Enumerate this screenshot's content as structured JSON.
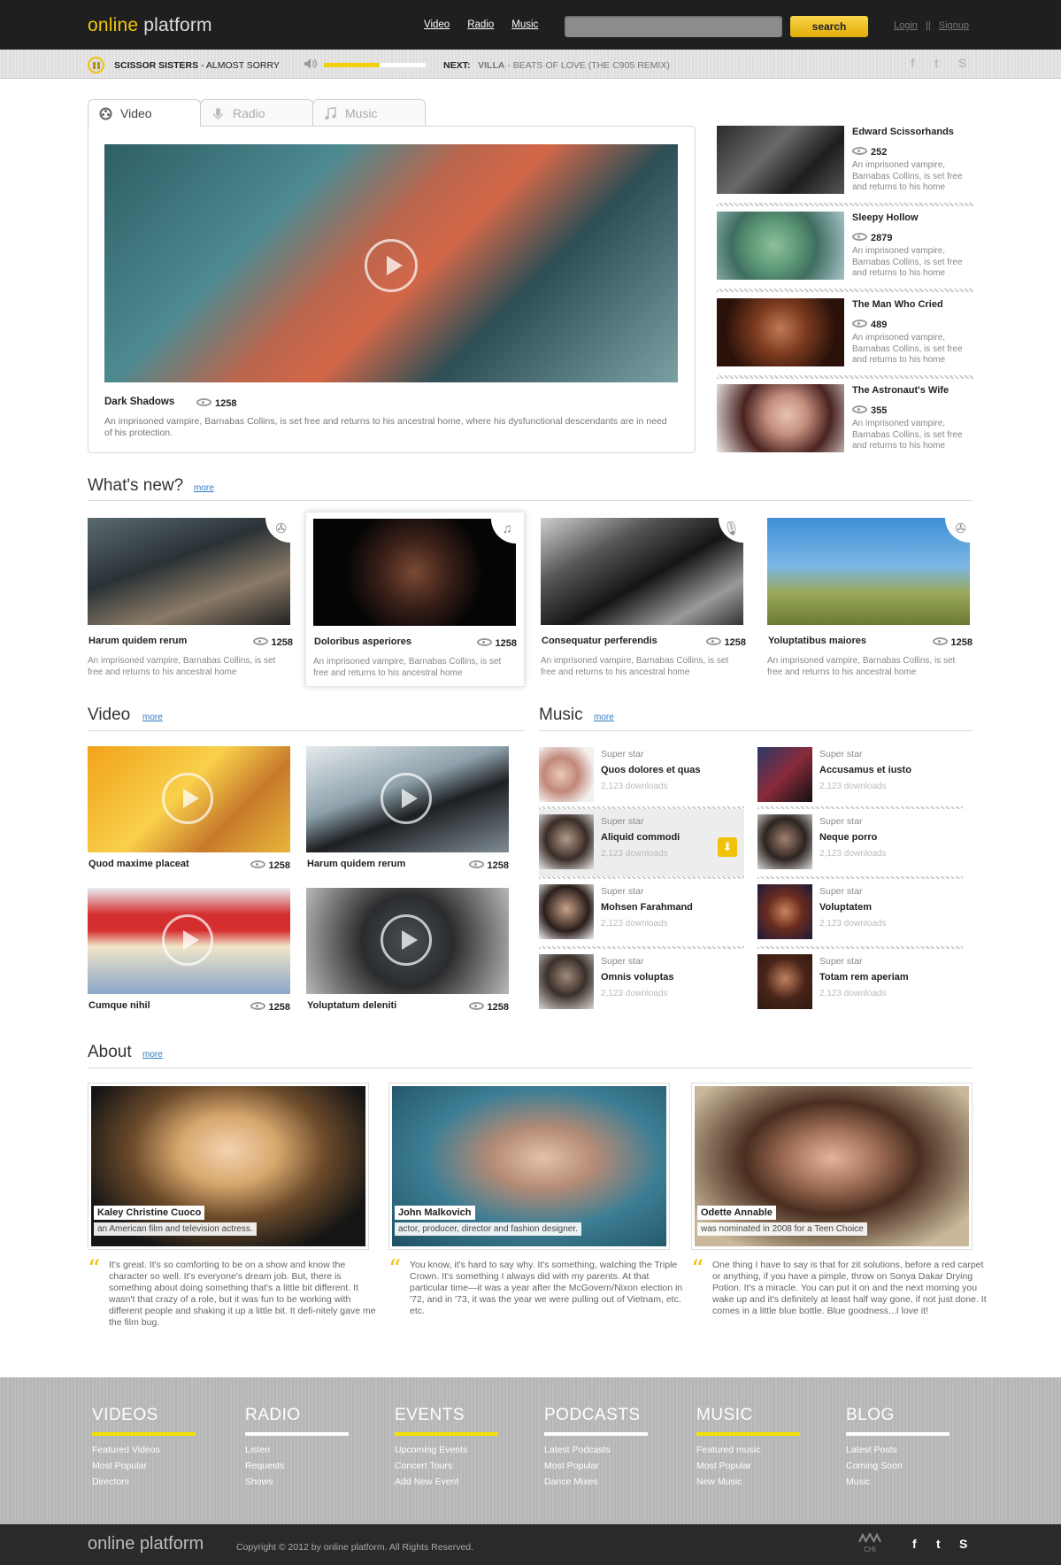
{
  "header": {
    "logo_part1": "online",
    "logo_part2": " platform",
    "nav": [
      "Video",
      "Radio",
      "Music"
    ],
    "search_placeholder": "",
    "search_button": "search",
    "login": "Login",
    "separator": "||",
    "signup": "Signup"
  },
  "player": {
    "artist": "SCISSOR SISTERS",
    "track": " - ALMOST SORRY",
    "next_label": "NEXT:",
    "next_artist": "VILLA",
    "next_track": " - BEATS OF LOVE (THE C905 REMIX)",
    "volume_level": 0.55
  },
  "tabs": [
    "Video",
    "Radio",
    "Music"
  ],
  "featured": {
    "title": "Dark Shadows",
    "views": "1258",
    "description": "An imprisoned vampire, Barnabas Collins, is set free and returns to his ancestral home, where his dysfunctional descendants are in need of his protection."
  },
  "side_list": [
    {
      "title": "Edward Scissorhands",
      "views": "252",
      "desc": "An imprisoned vampire, Barnabas Collins, is set free and returns to his home"
    },
    {
      "title": "Sleepy Hollow",
      "views": "2879",
      "desc": "An imprisoned vampire, Barnabas Collins, is set free and returns to his home"
    },
    {
      "title": "The Man Who Cried",
      "views": "489",
      "desc": "An imprisoned vampire, Barnabas Collins, is set free and returns to his home"
    },
    {
      "title": "The Astronaut's Wife",
      "views": "355",
      "desc": "An imprisoned vampire, Barnabas Collins, is set free and returns to his home"
    }
  ],
  "whats_new": {
    "title": "What's new?",
    "more": "more",
    "items": [
      {
        "title": "Harum quidem rerum",
        "views": "1258",
        "desc": "An imprisoned vampire, Barnabas Collins, is set free and returns to his ancestral home",
        "icon": "film-reel-icon"
      },
      {
        "title": "Doloribus asperiores",
        "views": "1258",
        "desc": "An imprisoned vampire, Barnabas Collins, is set free and returns to his ancestral home",
        "icon": "music-note-icon"
      },
      {
        "title": "Consequatur perferendis",
        "views": "1258",
        "desc": "An imprisoned vampire, Barnabas Collins, is set free and returns to his ancestral home",
        "icon": "microphone-icon"
      },
      {
        "title": "Yoluptatibus maiores",
        "views": "1258",
        "desc": "An imprisoned vampire, Barnabas Collins, is set free and returns to his ancestral home",
        "icon": "film-reel-icon"
      }
    ]
  },
  "video": {
    "title": "Video",
    "more": "more",
    "items": [
      {
        "title": "Quod maxime placeat",
        "views": "1258"
      },
      {
        "title": "Harum quidem rerum",
        "views": "1258"
      },
      {
        "title": "Cumque nihil",
        "views": "1258"
      },
      {
        "title": "Yoluptatum deleniti",
        "views": "1258"
      }
    ]
  },
  "music": {
    "title": "Music",
    "more": "more",
    "items": [
      {
        "star": "Super star",
        "name": "Quos dolores et quas",
        "downloads": "2,123 downloads"
      },
      {
        "star": "Super star",
        "name": "Accusamus et iusto",
        "downloads": "2,123 downloads"
      },
      {
        "star": "Super star",
        "name": "Aliquid commodi",
        "downloads": "2,123 downloads"
      },
      {
        "star": "Super star",
        "name": "Neque porro",
        "downloads": "2,123 downloads"
      },
      {
        "star": "Super star",
        "name": "Mohsen Farahmand",
        "downloads": "2,123 downloads"
      },
      {
        "star": "Super star",
        "name": "Voluptatem",
        "downloads": "2,123 downloads"
      },
      {
        "star": "Super star",
        "name": "Omnis voluptas",
        "downloads": "2,123 downloads"
      },
      {
        "star": "Super star",
        "name": "Totam rem aperiam",
        "downloads": "2,123 downloads"
      }
    ]
  },
  "about": {
    "title": "About",
    "more": "more",
    "people": [
      {
        "name": "Kaley Christine Cuoco",
        "role": "an American film and television actress.",
        "quote": "It's great. It's so comforting to be on a show and know the character so well. It's everyone's dream job. But, there is something about doing something that's a little bit different. It wasn't that crazy of a role, but it was fun to be working with different people and shaking it up a little bit. It defi-nitely gave me the film bug."
      },
      {
        "name": "John Malkovich",
        "role": "actor, producer, director and fashion designer.",
        "quote": "You know, it's hard to say why. It's something, watching the Triple Crown. It's something I always did with my parents. At that particular time—it was a year after the McGovern/Nixon election in '72, and in '73, it was the year we were pulling out of Vietnam, etc. etc."
      },
      {
        "name": "Odette Annable",
        "role": "was nominated in 2008 for a Teen Choice",
        "quote": "One thing I have to say is that for zit solutions, before a red carpet or anything, if you have a pimple, throw on Sonya Dakar Drying Potion. It's a miracle. You can put it on and the next morning you wake up and it's definitely at least half way gone, if not just done. It comes in a little blue bottle. Blue goodness...I love it!"
      }
    ]
  },
  "footer": {
    "columns": [
      {
        "head": "VIDEOS",
        "bar": "#f2e200",
        "links": [
          "Featured Videos",
          "Most Popular",
          "Directors"
        ]
      },
      {
        "head": "RADIO",
        "bar": "#ffffff",
        "links": [
          "Listen",
          "Requests",
          "Shows"
        ]
      },
      {
        "head": "EVENTS",
        "bar": "#f2e200",
        "links": [
          "Upcoming Events",
          "Concert Tours",
          "Add New Event"
        ]
      },
      {
        "head": "PODCASTS",
        "bar": "#ffffff",
        "links": [
          "Latest Podcasts",
          "Most Popular",
          "Dance Mixes"
        ]
      },
      {
        "head": "MUSIC",
        "bar": "#f2e200",
        "links": [
          "Featured music",
          "Most Popular",
          "New Music"
        ]
      },
      {
        "head": "BLOG",
        "bar": "#ffffff",
        "links": [
          "Latest Posts",
          "Coming Soon",
          "Music"
        ]
      }
    ],
    "logo": "online platform",
    "copyright": "Copyright © 2012 by online platform. All Rights Reserved.",
    "badge": "CHI"
  },
  "colors": {
    "accent": "#f2c20b",
    "link": "#2f7bc5",
    "dark": "#1f1f1f"
  }
}
